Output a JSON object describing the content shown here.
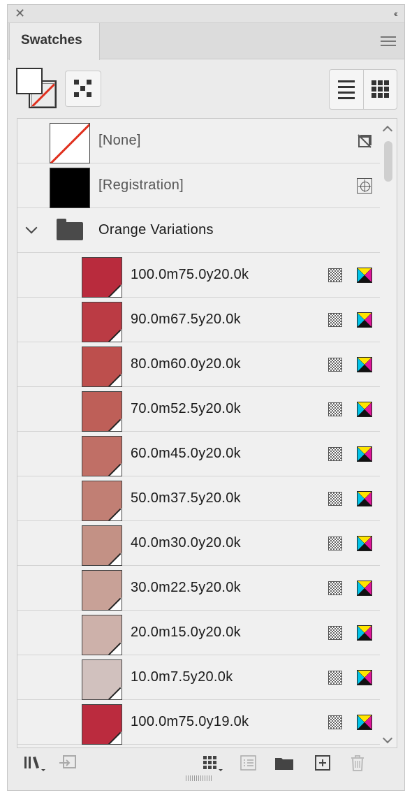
{
  "window": {
    "close_glyph": "✕",
    "collapse_glyph": "‹‹"
  },
  "tabs": [
    {
      "label": "Swatches",
      "active": true
    }
  ],
  "toolbar": {
    "fill_stroke": "fill-stroke-proxy-icon",
    "swatch_options": "dotted-grid-icon",
    "views": [
      "list-view-icon",
      "thumbnail-view-icon"
    ]
  },
  "colors": {
    "none_slash": "#e0301e",
    "registration": "#000000",
    "panel_bg": "#ebebeb",
    "list_bg": "#f0f0f0"
  },
  "swatches": {
    "none": {
      "label": "[None]",
      "icon": "no-edit-icon"
    },
    "registration": {
      "label": "[Registration]",
      "icon": "registration-target-icon"
    },
    "group": {
      "label": "Orange Variations",
      "icon": "folder-icon",
      "expanded": true,
      "items": [
        {
          "label": "100.0m75.0y20.0k",
          "color": "#b92b3d"
        },
        {
          "label": "90.0m67.5y20.0k",
          "color": "#bb3b44"
        },
        {
          "label": "80.0m60.0y20.0k",
          "color": "#bd4f4d"
        },
        {
          "label": "70.0m52.5y20.0k",
          "color": "#be5f58"
        },
        {
          "label": "60.0m45.0y20.0k",
          "color": "#c06f66"
        },
        {
          "label": "50.0m37.5y20.0k",
          "color": "#c17f74"
        },
        {
          "label": "40.0m30.0y20.0k",
          "color": "#c39185"
        },
        {
          "label": "30.0m22.5y20.0k",
          "color": "#c8a197"
        },
        {
          "label": "20.0m15.0y20.0k",
          "color": "#cdb1aa"
        },
        {
          "label": "10.0m7.5y20.0k",
          "color": "#d1c1be"
        },
        {
          "label": "100.0m75.0y19.0k",
          "color": "#bb2b3e"
        }
      ]
    }
  },
  "bottom_toolbar": [
    "libraries-icon",
    "place-swatch-icon",
    "show-swatch-kinds-icon",
    "swatch-options-icon",
    "new-color-group-icon",
    "new-swatch-icon",
    "delete-swatch-icon"
  ]
}
